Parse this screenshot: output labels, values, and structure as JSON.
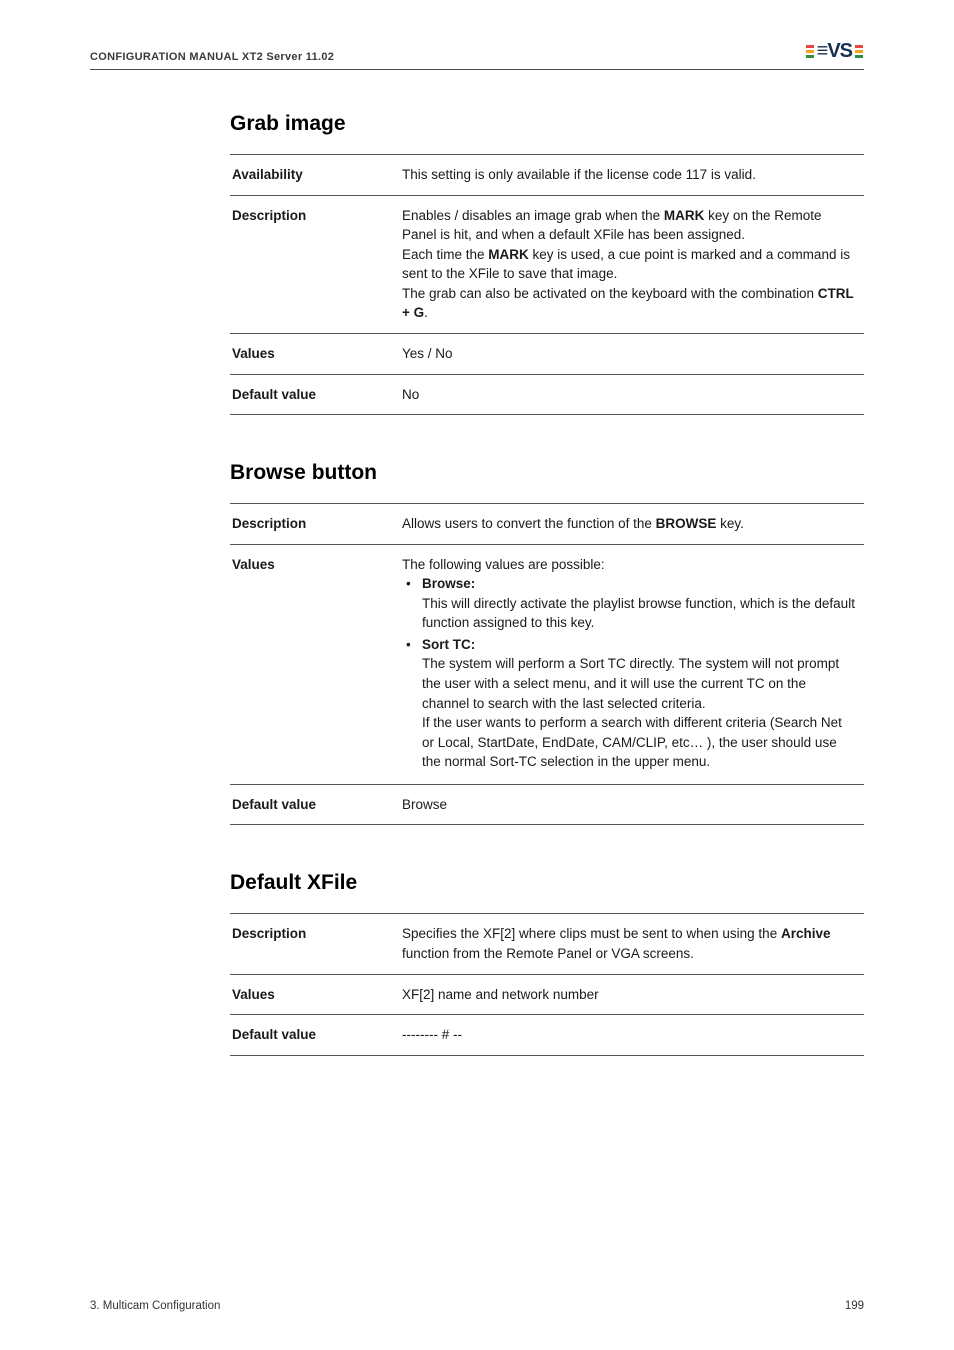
{
  "header": {
    "title": "CONFIGURATION MANUAL  XT2 Server 11.02"
  },
  "sections": [
    {
      "heading": "Grab image",
      "rows": [
        {
          "label": "Availability",
          "type": "text",
          "content": "This setting is only available if the license code 117 is valid."
        },
        {
          "label": "Description",
          "type": "html_desc1"
        },
        {
          "label": "Values",
          "type": "text",
          "content": "Yes / No"
        },
        {
          "label": "Default value",
          "type": "text",
          "content": "No"
        }
      ],
      "desc1": {
        "line1a": "Enables / disables an image grab when the ",
        "mark": "MARK",
        "line1b": " key on the Remote Panel is hit, and when a default XFile has been assigned.",
        "line2a": "Each time the ",
        "line2b": " key is used, a cue point is marked and a command is sent to the XFile to save that image.",
        "line3a": "The grab can also be activated on the keyboard with the combination ",
        "ctrlg": "CTRL + G",
        "line3b": "."
      }
    },
    {
      "heading": "Browse button",
      "rows": [
        {
          "label": "Description",
          "type": "html_desc2"
        },
        {
          "label": "Values",
          "type": "html_values2"
        },
        {
          "label": "Default value",
          "type": "text",
          "content": "Browse"
        }
      ],
      "desc2": {
        "pre": "Allows users to convert the function of the ",
        "browse": "BROWSE",
        "post": " key."
      },
      "values2": {
        "intro": "The following values are possible:",
        "items": [
          {
            "head": "Browse:",
            "body": "This will directly activate the playlist browse function, which is the default function assigned to this key."
          },
          {
            "head": "Sort TC:",
            "body": "The system will perform a Sort TC directly. The system will not prompt the user with a select menu, and it will use the current TC on the channel to search with the last selected criteria.\nIf the user wants to perform a search with different criteria (Search Net or Local, StartDate, EndDate, CAM/CLIP, etc… ), the user should use the normal Sort-TC selection in the upper menu."
          }
        ]
      }
    },
    {
      "heading": "Default XFile",
      "rows": [
        {
          "label": "Description",
          "type": "html_desc3"
        },
        {
          "label": "Values",
          "type": "text",
          "content": "XF[2] name and network number"
        },
        {
          "label": "Default value",
          "type": "text",
          "content": "-------- # --"
        }
      ],
      "desc3": {
        "pre": "Specifies the XF[2] where clips must be sent to when using the ",
        "archive": "Archive",
        "post": " function from the Remote Panel or VGA screens."
      }
    }
  ],
  "footer": {
    "left": "3. Multicam Configuration",
    "right": "199"
  }
}
